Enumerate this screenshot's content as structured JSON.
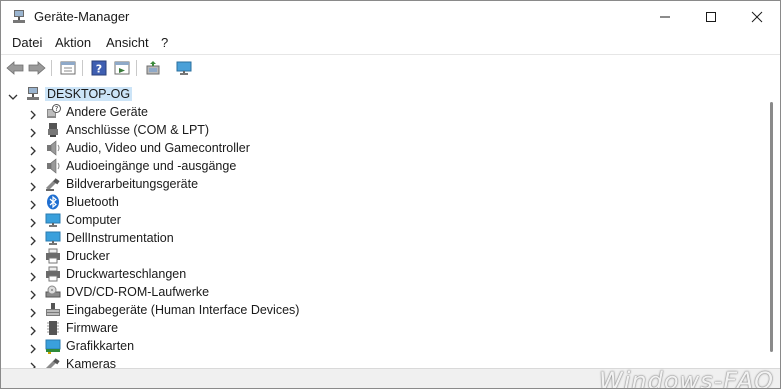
{
  "window": {
    "title": "Geräte-Manager"
  },
  "menu": [
    "Datei",
    "Aktion",
    "Ansicht",
    "?"
  ],
  "tree": {
    "root": "DESKTOP-OG",
    "items": [
      {
        "label": "Andere Geräte",
        "icon": "unknown-device-icon"
      },
      {
        "label": "Anschlüsse (COM & LPT)",
        "icon": "port-icon"
      },
      {
        "label": "Audio, Video und Gamecontroller",
        "icon": "speaker-icon"
      },
      {
        "label": "Audioeingänge und -ausgänge",
        "icon": "speaker-icon"
      },
      {
        "label": "Bildverarbeitungsgeräte",
        "icon": "camera-icon"
      },
      {
        "label": "Bluetooth",
        "icon": "bluetooth-icon"
      },
      {
        "label": "Computer",
        "icon": "monitor-icon"
      },
      {
        "label": "DellInstrumentation",
        "icon": "monitor-icon"
      },
      {
        "label": "Drucker",
        "icon": "printer-icon"
      },
      {
        "label": "Druckwarteschlangen",
        "icon": "printer-icon"
      },
      {
        "label": "DVD/CD-ROM-Laufwerke",
        "icon": "disc-drive-icon"
      },
      {
        "label": "Eingabegeräte (Human Interface Devices)",
        "icon": "hid-icon"
      },
      {
        "label": "Firmware",
        "icon": "chip-icon"
      },
      {
        "label": "Grafikkarten",
        "icon": "display-adapter-icon"
      },
      {
        "label": "Kameras",
        "icon": "camera-icon"
      }
    ]
  },
  "status": {
    "watermark": "Windows-FAQ"
  }
}
